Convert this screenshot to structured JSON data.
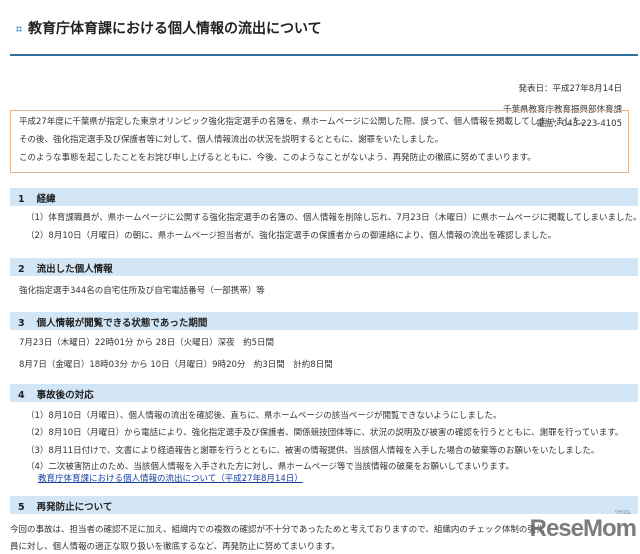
{
  "title": "教育庁体育課における個人情報の流出について",
  "date": "発表日：平成27年8月14日",
  "org": "千葉県教育庁教育振興部体育課",
  "tel": "電話：043-223-4105",
  "notice": [
    "平成27年度に千葉県が指定した東京オリンピック強化指定選手の名簿を、県ホームページに公開した際、誤って、個人情報を掲載してしまいました。",
    "その後、強化指定選手及び保護者等に対して、個人情報流出の状況を説明するとともに、謝罪をいたしました。",
    "このような事態を起こしたことをお詫び申し上げるとともに、今後、このようなことがないよう、再発防止の徹底に努めてまいります。"
  ],
  "sections": [
    {
      "num": "1",
      "title": "経緯",
      "lines": [
        "（1）体育課職員が、県ホームページに公開する強化指定選手の名簿の、個人情報を削除し忘れ、7月23日（木曜日）に県ホームページに掲載してしまいました。",
        "（2）8月10日（月曜日）の朝に、県ホームページ担当者が、強化指定選手の保護者からの御連絡により、個人情報の流出を確認しました。"
      ]
    },
    {
      "num": "2",
      "title": "流出した個人情報",
      "lines": [
        "強化指定選手344名の自宅住所及び自宅電話番号（一部携帯）等"
      ]
    },
    {
      "num": "3",
      "title": "個人情報が閲覧できる状態であった期間",
      "lines": [
        "7月23日（木曜日）22時01分 から 28日（火曜日）深夜　約5日間",
        "8月7日（金曜日）18時03分 から 10日（月曜日）9時20分　約3日間　計約8日間"
      ]
    },
    {
      "num": "4",
      "title": "事故後の対応",
      "lines": [
        "（1）8月10日（月曜日）、個人情報の流出を確認後、直ちに、県ホームページの該当ページが閲覧できないようにしました。",
        "（2）8月10日（月曜日）から電話により、強化指定選手及び保護者、関係競技団体等に、状況の説明及び被害の確認を行うとともに、謝罪を行っています。",
        "（3）8月11日付けで、文書により経過報告と謝罪を行うとともに、被害の情報提供、当該個人情報を入手した場合の破棄等のお願いをいたしました。",
        "（4）二次被害防止のため、当該個人情報を入手された方に対し、県ホームページ等で当該情報の破棄をお願いしてまいります。"
      ],
      "link": "教育庁体育課における個人情報の流出について（平成27年8月14日）"
    },
    {
      "num": "5",
      "title": "再発防止について",
      "lines": [
        "今回の事故は、担当者の確認不足に加え、組織内での複数の確認が不十分であったためと考えておりますので、組織内のチェック体制の強化",
        "員に対し、個人情報の適正な取り扱いを徹底するなど、再発防止に努めてまいります。"
      ]
    }
  ],
  "watermark": {
    "text": "ReseMom",
    "small": "リセマム"
  }
}
